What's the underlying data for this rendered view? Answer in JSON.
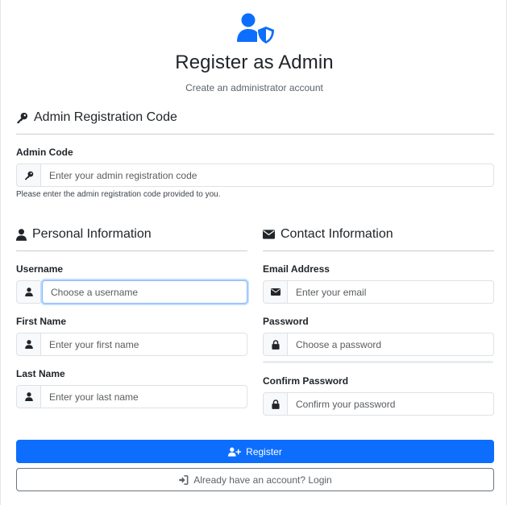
{
  "header": {
    "title": "Register as Admin",
    "subtitle": "Create an administrator account",
    "icon": "user-shield-icon"
  },
  "admin_section": {
    "heading": "Admin Registration Code",
    "icon": "key-icon",
    "code_label": "Admin Code",
    "code_placeholder": "Enter your admin registration code",
    "code_help": "Please enter the admin registration code provided to you."
  },
  "personal_section": {
    "heading": "Personal Information",
    "icon": "user-icon",
    "username_label": "Username",
    "username_placeholder": "Choose a username",
    "first_name_label": "First Name",
    "first_name_placeholder": "Enter your first name",
    "last_name_label": "Last Name",
    "last_name_placeholder": "Enter your last name"
  },
  "contact_section": {
    "heading": "Contact Information",
    "icon": "envelope-icon",
    "email_label": "Email Address",
    "email_placeholder": "Enter your email",
    "password_label": "Password",
    "password_placeholder": "Choose a password",
    "confirm_label": "Confirm Password",
    "confirm_placeholder": "Confirm your password"
  },
  "actions": {
    "register_label": "Register",
    "login_label": "Already have an account? Login"
  },
  "colors": {
    "primary": "#0d6efd",
    "secondary": "#6c757d",
    "focus_ring": "#86b7fe"
  }
}
